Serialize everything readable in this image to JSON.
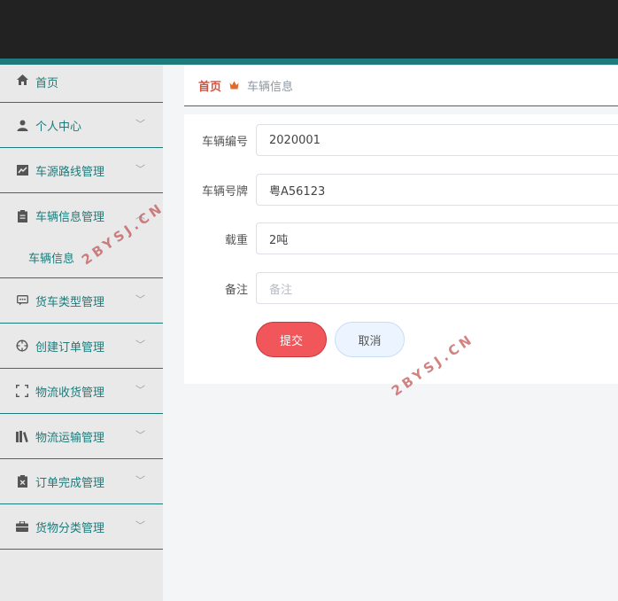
{
  "sidebar": {
    "items": [
      {
        "label": "首页",
        "icon": "home-icon"
      },
      {
        "label": "个人中心",
        "icon": "user-icon"
      },
      {
        "label": "车源路线管理",
        "icon": "chart-icon"
      },
      {
        "label": "车辆信息管理",
        "icon": "clipboard-icon",
        "sub": [
          "车辆信息"
        ]
      },
      {
        "label": "货车类型管理",
        "icon": "chat-icon"
      },
      {
        "label": "创建订单管理",
        "icon": "crosshair-icon"
      },
      {
        "label": "物流收货管理",
        "icon": "scan-frame-icon"
      },
      {
        "label": "物流运输管理",
        "icon": "books-icon"
      },
      {
        "label": "订单完成管理",
        "icon": "clipboard-x-icon"
      },
      {
        "label": "货物分类管理",
        "icon": "briefcase-icon"
      }
    ]
  },
  "breadcrumb": {
    "home": "首页",
    "current": "车辆信息"
  },
  "form": {
    "fields": [
      {
        "label": "车辆编号",
        "value": "2020001",
        "placeholder": ""
      },
      {
        "label": "车辆号牌",
        "value": "粤A56123",
        "placeholder": ""
      },
      {
        "label": "载重",
        "value": "2吨",
        "placeholder": ""
      },
      {
        "label": "备注",
        "value": "",
        "placeholder": "备注"
      }
    ],
    "submit_label": "提交",
    "cancel_label": "取消"
  },
  "watermark": "2BYSJ.CN",
  "colors": {
    "accent": "#1d7b7b",
    "topbar": "#222222",
    "submit": "#f0565a",
    "breadcrumb_home": "#d2513f"
  }
}
